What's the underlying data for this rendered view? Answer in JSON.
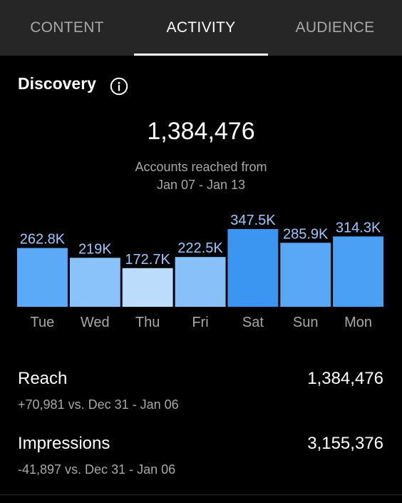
{
  "tabs": [
    {
      "label": "CONTENT",
      "active": false
    },
    {
      "label": "ACTIVITY",
      "active": true
    },
    {
      "label": "AUDIENCE",
      "active": false
    }
  ],
  "discovery": {
    "title": "Discovery",
    "info_icon": "info-icon",
    "total": "1,384,476",
    "caption_line1": "Accounts reached from",
    "caption_line2": "Jan 07 - Jan 13"
  },
  "colors": {
    "background": "#000000",
    "tab_bar": "#262626",
    "bar_label": "#9bc7fb",
    "day_label": "#a8a8a8"
  },
  "chart_data": {
    "type": "bar",
    "categories": [
      "Tue",
      "Wed",
      "Thu",
      "Fri",
      "Sat",
      "Sun",
      "Mon"
    ],
    "values": [
      262.8,
      219,
      172.7,
      222.5,
      347.5,
      285.9,
      314.3
    ],
    "value_labels": [
      "262.8K",
      "219K",
      "172.7K",
      "222.5K",
      "347.5K",
      "285.9K",
      "314.3K"
    ],
    "bar_colors": [
      "#5aaaf8",
      "#8ac2fa",
      "#bcdcfc",
      "#88c0fa",
      "#3a96f1",
      "#58a8f7",
      "#4aa0f5"
    ],
    "title": "",
    "xlabel": "",
    "ylabel": "",
    "ylim": [
      0,
      347.5
    ],
    "grid": false
  },
  "metrics": [
    {
      "label": "Reach",
      "value": "1,384,476",
      "compare": "+70,981 vs. Dec 31 - Jan 06"
    },
    {
      "label": "Impressions",
      "value": "3,155,376",
      "compare": "-41,897 vs. Dec 31 - Jan 06"
    }
  ]
}
